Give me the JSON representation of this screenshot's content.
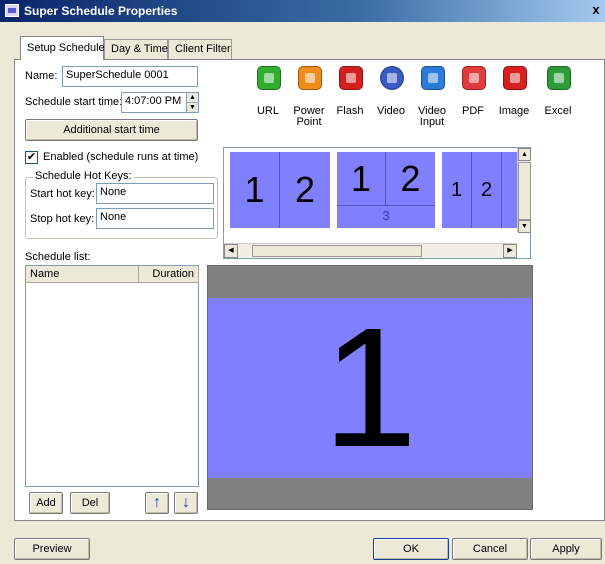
{
  "window": {
    "title": "Super Schedule Properties",
    "close_label": "x"
  },
  "tabs": [
    {
      "label": "Setup Schedule"
    },
    {
      "label": "Day & Time"
    },
    {
      "label": "Client Filter"
    }
  ],
  "setup": {
    "name_label": "Name:",
    "name_value": "SuperSchedule 0001",
    "start_time_label": "Schedule start time:",
    "start_time_value": "4:07:00 PM",
    "additional_button": "Additional start time",
    "enabled_label": "Enabled (schedule runs at time)",
    "enabled_checked": "✔",
    "hotkeys_legend": "Schedule Hot Keys:",
    "start_hotkey_label": "Start hot key:",
    "start_hotkey_value": "None",
    "stop_hotkey_label": "Stop hot key:",
    "stop_hotkey_value": "None",
    "schedule_list_label": "Schedule list:",
    "columns": [
      "Name",
      "Duration"
    ],
    "add_button": "Add",
    "del_button": "Del",
    "up_arrow": "↑",
    "down_arrow": "↓"
  },
  "media_types": [
    {
      "label": "URL",
      "icon": "url-icon",
      "color": "#2fae2f"
    },
    {
      "label": "Power\nPoint",
      "icon": "powerpoint-icon",
      "color": "#f08a1a"
    },
    {
      "label": "Flash",
      "icon": "flash-icon",
      "color": "#d31f1f"
    },
    {
      "label": "Video",
      "icon": "video-icon",
      "color": "#3b5bc4"
    },
    {
      "label": "Video\nInput",
      "icon": "video-input-icon",
      "color": "#2b7bd8"
    },
    {
      "label": "PDF",
      "icon": "pdf-icon",
      "color": "#e23b3b"
    },
    {
      "label": "Image",
      "icon": "image-icon",
      "color": "#d82020"
    },
    {
      "label": "Excel",
      "icon": "excel-icon",
      "color": "#2f9a3a"
    }
  ],
  "layouts": [
    {
      "cells": [
        "1",
        "2"
      ]
    },
    {
      "cells": [
        "1",
        "2",
        "3"
      ]
    },
    {
      "cells": [
        "1",
        "2"
      ]
    }
  ],
  "preview": {
    "zone": "1"
  },
  "footer": {
    "preview_button": "Preview",
    "ok_button": "OK",
    "cancel_button": "Cancel",
    "apply_button": "Apply"
  },
  "colors": {
    "zone_blue": "#8080ff",
    "title_gradient_start": "#0a246a"
  }
}
